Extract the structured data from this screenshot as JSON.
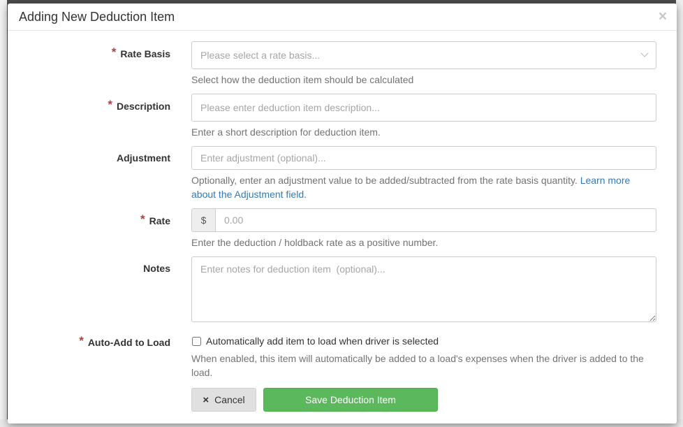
{
  "modal": {
    "title": "Adding New Deduction Item",
    "close_symbol": "×"
  },
  "form": {
    "rate_basis": {
      "label": "Rate Basis",
      "required": true,
      "placeholder": "Please select a rate basis...",
      "help": "Select how the deduction item should be calculated"
    },
    "description": {
      "label": "Description",
      "required": true,
      "placeholder": "Please enter deduction item description...",
      "help": "Enter a short description for deduction item."
    },
    "adjustment": {
      "label": "Adjustment",
      "required": false,
      "placeholder": "Enter adjustment (optional)...",
      "help": "Optionally, enter an adjustment value to be added/subtracted from the rate basis quantity.",
      "help_link": "Learn more about the Adjustment field."
    },
    "rate": {
      "label": "Rate",
      "required": true,
      "prefix": "$",
      "placeholder": "0.00",
      "help": "Enter the deduction / holdback rate as a positive number."
    },
    "notes": {
      "label": "Notes",
      "required": false,
      "placeholder": "Enter notes for deduction item  (optional)..."
    },
    "auto_add": {
      "label": "Auto-Add to Load",
      "required": true,
      "checkbox_label": "Automatically add item to load when driver is selected",
      "checked": false,
      "help": "When enabled, this item will automatically be added to a load's expenses when the driver is added to the load."
    },
    "required_marker": "*"
  },
  "buttons": {
    "cancel_label": "Cancel",
    "cancel_icon": "×",
    "save_label": "Save Deduction Item"
  },
  "colors": {
    "required": "#a94442",
    "save_button": "#5cb85c",
    "link": "#337ab7"
  }
}
